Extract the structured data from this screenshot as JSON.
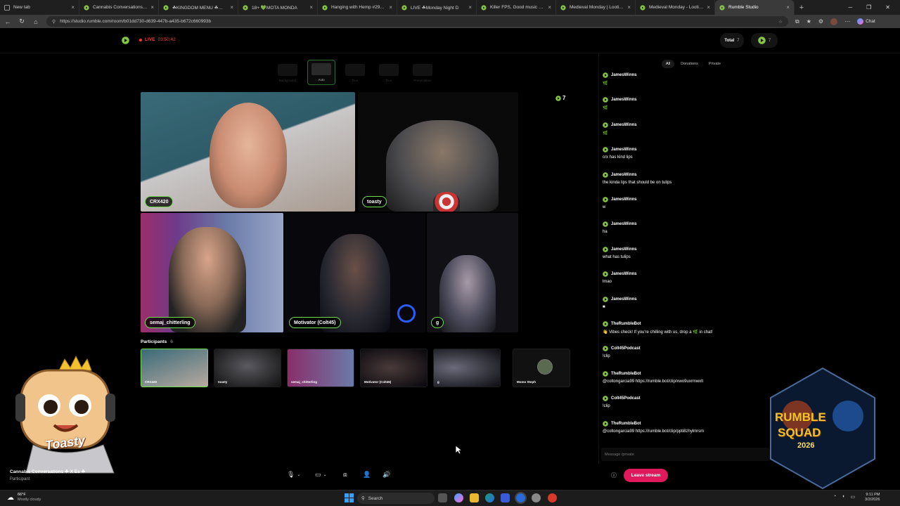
{
  "browser": {
    "tabs": [
      {
        "label": "New tab",
        "icon": "newtab-icon"
      },
      {
        "label": "Cannabis Conversations wit",
        "icon": "rumble-icon"
      },
      {
        "label": "☘KINGDOM MENU ☘🎮🎮 ☘",
        "icon": "rumble-icon"
      },
      {
        "label": "18+ 💚MOTA MONDA",
        "icon": "rumble-icon"
      },
      {
        "label": "Hanging with Hemp #296 o",
        "icon": "rumble-icon"
      },
      {
        "label": "LIVE ☘Monday Night D",
        "icon": "rumble-icon"
      },
      {
        "label": "Killer FPS, Good music and Bad",
        "icon": "rumble-icon"
      },
      {
        "label": "Medieval Monday | Looting, Sla",
        "icon": "rumble-icon"
      },
      {
        "label": "Medieval Monday - Looting, Sla",
        "icon": "rumble-icon"
      },
      {
        "label": "Rumble Studio",
        "icon": "rumble-icon",
        "active": true
      }
    ],
    "url": "https://studio.rumble.com/room/b01dd730-d639-447b-a435-b672c660993b"
  },
  "header": {
    "live_label": "LIVE",
    "timer": "03:50:42",
    "total_label": "Total",
    "total_count": "7",
    "viewer_count": "7"
  },
  "layouts": [
    {
      "label": "Background"
    },
    {
      "label": "Auto",
      "active": true
    },
    {
      "label": "Duo"
    },
    {
      "label": "Duo"
    },
    {
      "label": "Presentation"
    }
  ],
  "stage": {
    "viewer_badge": "7",
    "tiles": [
      {
        "name": "CRX420"
      },
      {
        "name": "toasty"
      },
      {
        "name": "semaj_chitterling"
      },
      {
        "name": "Motivator (Colt45)"
      },
      {
        "name": "g"
      }
    ]
  },
  "participants": {
    "label": "Participants",
    "count": "6",
    "thumbs": [
      {
        "name": "CRX420"
      },
      {
        "name": "toasty"
      },
      {
        "name": "semaj_chitterling"
      },
      {
        "name": "Motivator (Colt45)"
      },
      {
        "name": "g"
      },
      {
        "name": "Momo Steph"
      }
    ]
  },
  "chat": {
    "tabs": [
      "All",
      "Donations",
      "Private"
    ],
    "messages": [
      {
        "user": "JamesWinns",
        "text": "🌿"
      },
      {
        "user": "JamesWinns",
        "text": "🌿"
      },
      {
        "user": "JamesWinns",
        "text": "🌿"
      },
      {
        "user": "JamesWinns",
        "text": "crx has kind lips"
      },
      {
        "user": "JamesWinns",
        "text": "the kinda lips that should be on tulips"
      },
      {
        "user": "JamesWinns",
        "text": "w"
      },
      {
        "user": "JamesWinns",
        "text": "ha"
      },
      {
        "user": "JamesWinns",
        "text": "what has tulips"
      },
      {
        "user": "JamesWinns",
        "text": "lmao"
      },
      {
        "user": "JamesWinns",
        "text": "■"
      },
      {
        "user": "TheRumbleBot",
        "text": "👋 Vibes check! If you're chilling with us, drop a 🌿 in chat!"
      },
      {
        "user": "Colt45Podcast",
        "text": "!clip"
      },
      {
        "user": "TheRumbleBot",
        "text": "@coltongarcia99 https://rumble.bot/clip/xwo9uxrmwxlt"
      },
      {
        "user": "Colt45Podcast",
        "text": "!clip"
      },
      {
        "user": "TheRumbleBot",
        "text": "@coltongarcia99 https://rumble.bot/clip/ppti8zhylmrsm"
      }
    ],
    "input_placeholder": "Message /private"
  },
  "overlay": {
    "mascot_text": "Toasty",
    "badge_text_1": "RUMBLE",
    "badge_text_2": "SQUAD",
    "badge_year": "2026",
    "stream_title": "Cannabis Conversations ☘ X Es ☘",
    "stream_role": "Participant"
  },
  "controls": {
    "leave_label": "Leave stream"
  },
  "taskbar": {
    "weather_temp": "66°F",
    "weather_desc": "Mostly cloudy",
    "search_placeholder": "Search",
    "time": "9:11 PM",
    "date": "3/2/2026"
  },
  "colors": {
    "rumble_green": "#85c742",
    "live_red": "#ff3b3b",
    "leave_pink": "#e0195c",
    "badge_outline": "#6ee04a"
  }
}
